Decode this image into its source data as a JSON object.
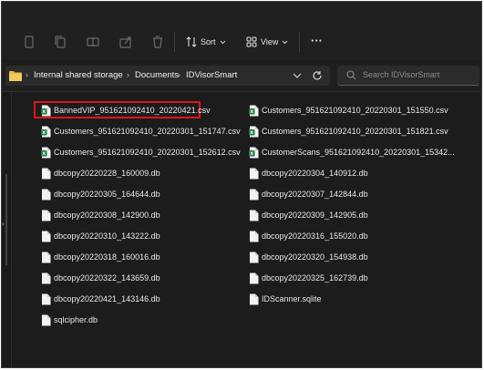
{
  "toolbar": {
    "sort_label": "Sort",
    "view_label": "View",
    "more_label": "···"
  },
  "address": {
    "crumbs": [
      "Internal shared storage",
      "Documents",
      "IDVisorSmart"
    ]
  },
  "search": {
    "placeholder": "Search IDVisorSmart"
  },
  "files": {
    "left": [
      {
        "name": "BannedVIP_951621092410_20220421.csv",
        "type": "csv"
      },
      {
        "name": "Customers_951621092410_20220301_151747.csv",
        "type": "csv"
      },
      {
        "name": "Customers_951621092410_20220301_152612.csv",
        "type": "csv"
      },
      {
        "name": "dbcopy20220228_160009.db",
        "type": "db"
      },
      {
        "name": "dbcopy20220305_164644.db",
        "type": "db"
      },
      {
        "name": "dbcopy20220308_142900.db",
        "type": "db"
      },
      {
        "name": "dbcopy20220310_143222.db",
        "type": "db"
      },
      {
        "name": "dbcopy20220318_160016.db",
        "type": "db"
      },
      {
        "name": "dbcopy20220322_143659.db",
        "type": "db"
      },
      {
        "name": "dbcopy20220421_143146.db",
        "type": "db"
      },
      {
        "name": "sqlcipher.db",
        "type": "db"
      }
    ],
    "right": [
      {
        "name": "Customers_951621092410_20220301_151550.csv",
        "type": "csv"
      },
      {
        "name": "Customers_951621092410_20220301_151821.csv",
        "type": "csv"
      },
      {
        "name": "CustomerScans_951621092410_20220301_15342...",
        "type": "csv"
      },
      {
        "name": "dbcopy20220304_140912.db",
        "type": "db"
      },
      {
        "name": "dbcopy20220307_142844.db",
        "type": "db"
      },
      {
        "name": "dbcopy20220309_142905.db",
        "type": "db"
      },
      {
        "name": "dbcopy20220316_155020.db",
        "type": "db"
      },
      {
        "name": "dbcopy20220320_154938.db",
        "type": "db"
      },
      {
        "name": "dbcopy20220325_162739.db",
        "type": "db"
      },
      {
        "name": "IDScanner.sqlite",
        "type": "sqlite"
      }
    ]
  },
  "colors": {
    "highlight": "#e0141b",
    "csv_green": "#1d7a3e"
  }
}
